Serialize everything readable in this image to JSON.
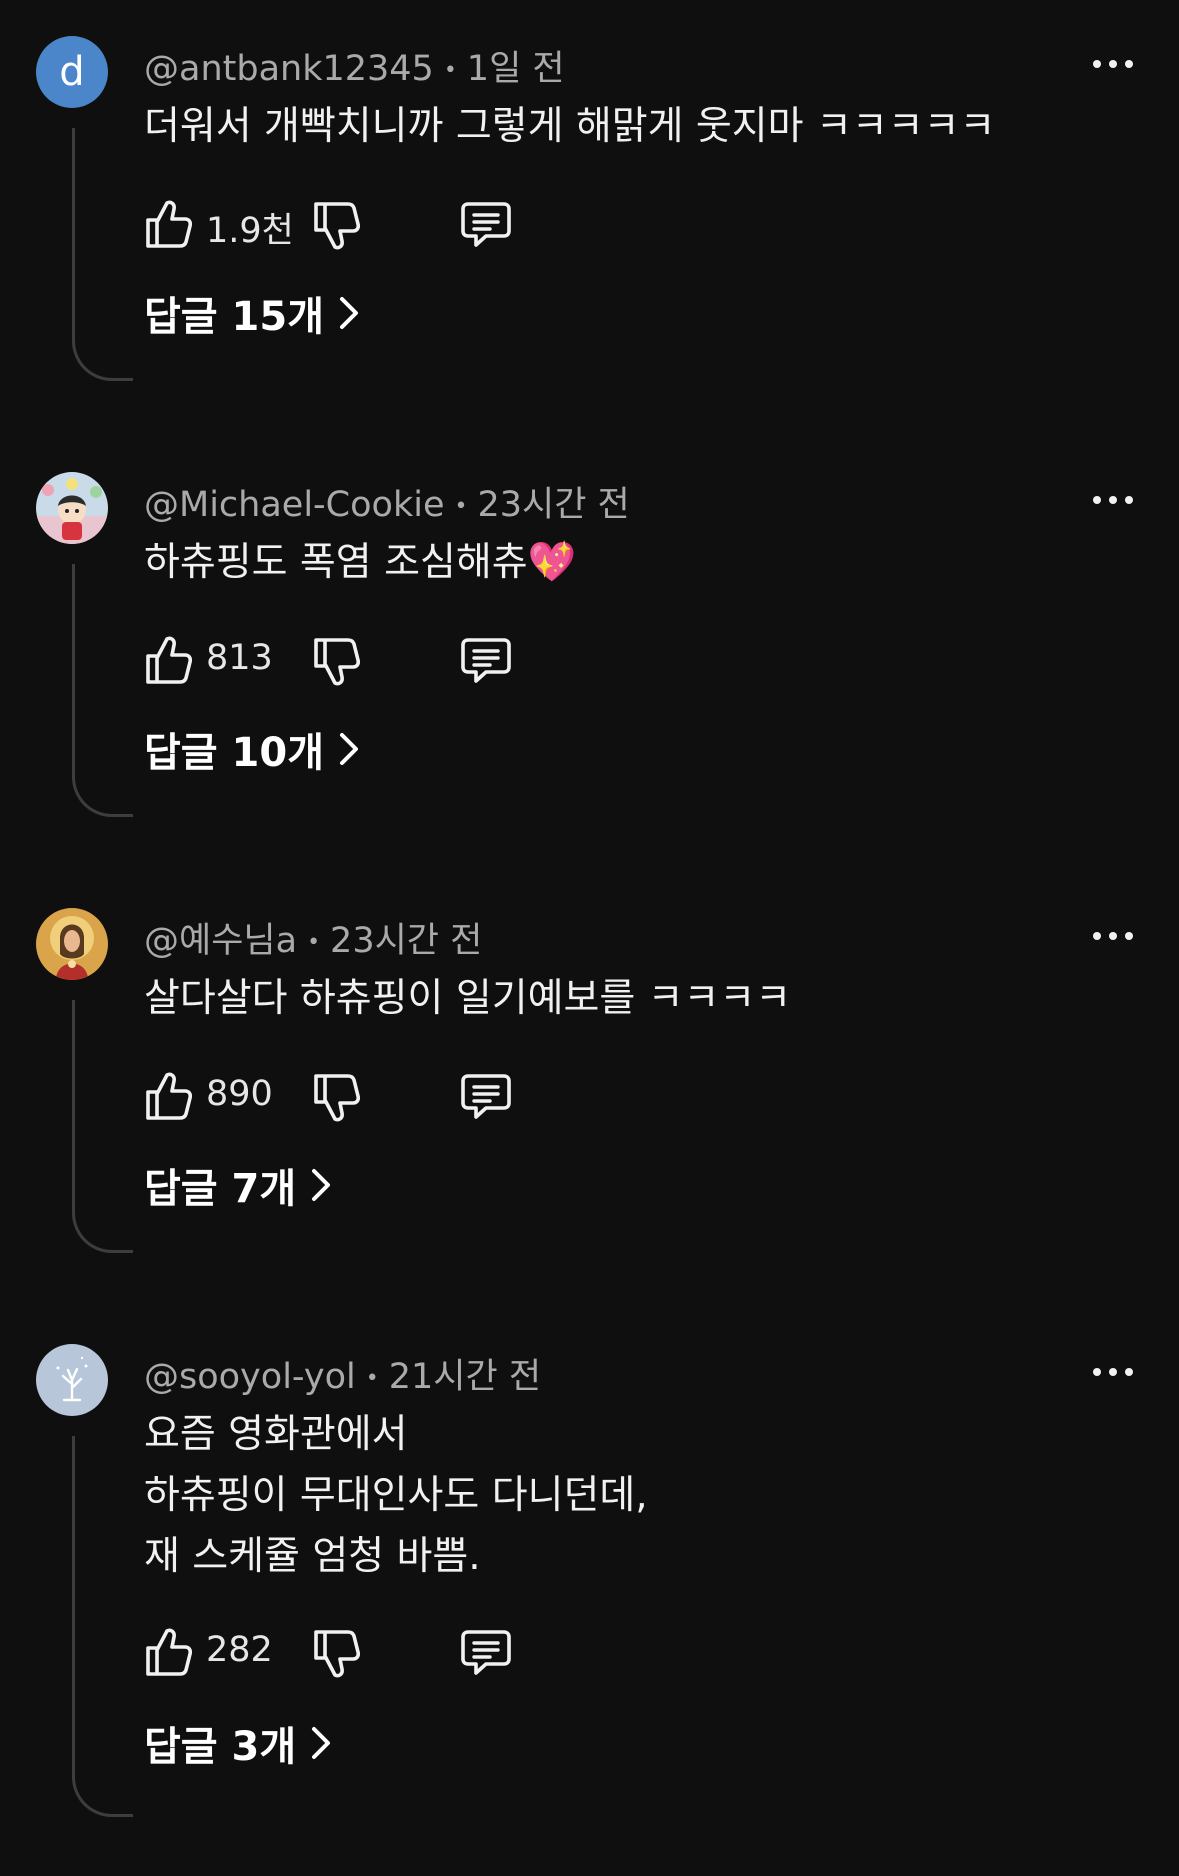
{
  "comments": [
    {
      "avatar_letter": "d",
      "avatar_color": "#4a86c9",
      "author": "@antbank12345",
      "time": "1일 전",
      "lines": [
        "더워서 개빡치니까 그렇게 해맑게 웃지마 ㅋㅋㅋㅋㅋ"
      ],
      "likes": "1.9천",
      "replies": "답글 15개"
    },
    {
      "avatar_icon": "character-avatar",
      "author": "@Michael-Cookie",
      "time": "23시간 전",
      "lines": [
        "하츄핑도 폭염 조심해츄💖"
      ],
      "likes": "813",
      "replies": "답글 10개"
    },
    {
      "avatar_icon": "portrait-avatar",
      "author": "@예수님a",
      "time": "23시간 전",
      "lines": [
        "살다살다 하츄핑이 일기예보를 ㅋㅋㅋㅋ"
      ],
      "likes": "890",
      "replies": "답글 7개"
    },
    {
      "avatar_icon": "plant-avatar",
      "author": "@sooyol-yol",
      "time": "21시간 전",
      "lines": [
        "요즘 영화관에서",
        "하츄핑이 무대인사도 다니던데,",
        "재 스케쥴 엄청 바쁨."
      ],
      "likes": "282",
      "replies": "답글 3개"
    }
  ],
  "icons": {
    "like": "thumbs-up-icon",
    "dislike": "thumbs-down-icon",
    "reply": "comment-icon",
    "more": "more-dots-icon",
    "chevron": "chevron-right-icon"
  }
}
